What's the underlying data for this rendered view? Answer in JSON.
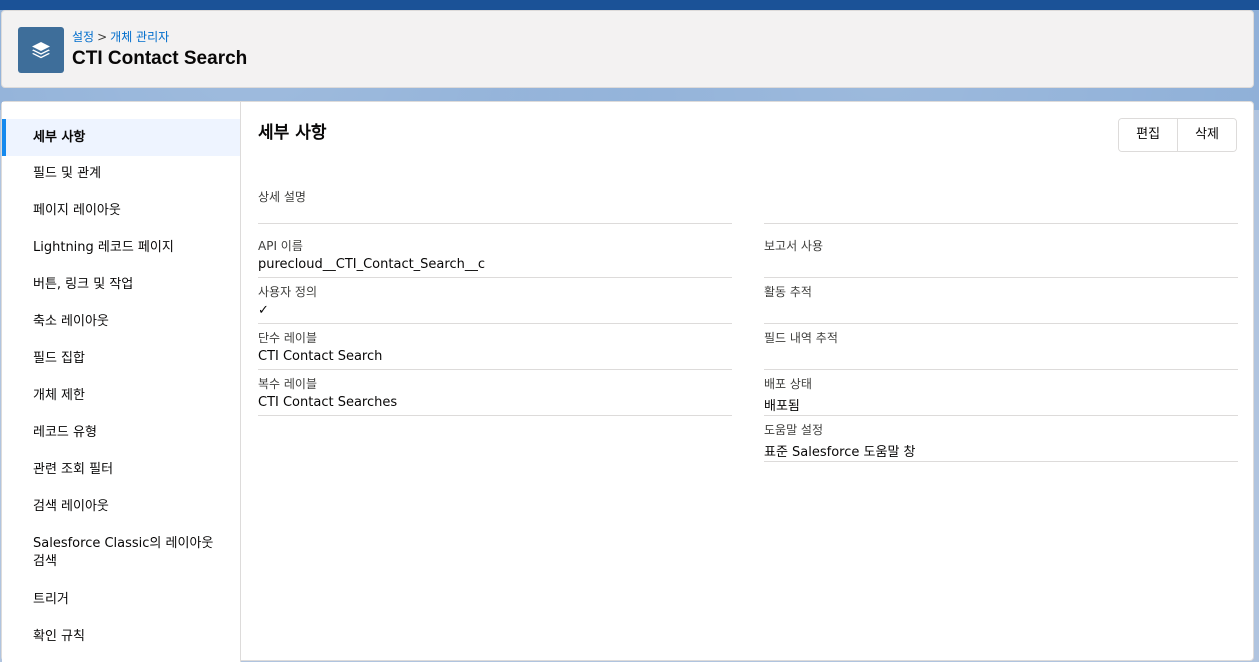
{
  "header": {
    "breadcrumb": [
      "설정",
      "개체 관리자"
    ],
    "breadcrumb_separator": ">",
    "title": "CTI Contact Search",
    "icon": "layers-icon"
  },
  "sidebar": {
    "items": [
      {
        "label": "세부 사항",
        "active": true
      },
      {
        "label": "필드 및 관계"
      },
      {
        "label": "페이지 레이아웃"
      },
      {
        "label": "Lightning 레코드 페이지"
      },
      {
        "label": "버튼, 링크 및 작업"
      },
      {
        "label": "축소 레이아웃"
      },
      {
        "label": "필드 집합"
      },
      {
        "label": "개체 제한"
      },
      {
        "label": "레코드 유형"
      },
      {
        "label": "관련 조회 필터"
      },
      {
        "label": "검색 레이아웃"
      },
      {
        "label": "Salesforce Classic의 레이아웃 검색",
        "line1": "Salesforce Classic의 레이아웃",
        "line2": "검색"
      },
      {
        "label": "트리거"
      },
      {
        "label": "확인 규칙"
      }
    ]
  },
  "details": {
    "title": "세부 사항",
    "edit_label": "편집",
    "delete_label": "삭제",
    "description_label": "상세 설명",
    "description_value": "",
    "left_fields": [
      {
        "label": "API 이름",
        "value": "purecloud__CTI_Contact_Search__c"
      },
      {
        "label": "사용자 정의",
        "value": "✓"
      },
      {
        "label": "단수 레이블",
        "value": "CTI Contact Search"
      },
      {
        "label": "복수 레이블",
        "value": "CTI Contact Searches"
      }
    ],
    "right_fields": [
      {
        "label": "보고서 사용",
        "value": ""
      },
      {
        "label": "활동 추적",
        "value": ""
      },
      {
        "label": "필드 내역 추적",
        "value": ""
      },
      {
        "label": "배포 상태",
        "value": "배포됨"
      },
      {
        "label": "도움말 설정",
        "value": "표준 Salesforce 도움말 창"
      }
    ]
  },
  "colors": {
    "brand": "#1b5297",
    "icon_bg": "#3e6e9a",
    "link": "#006dcc",
    "active_nav_border": "#1589ee"
  }
}
